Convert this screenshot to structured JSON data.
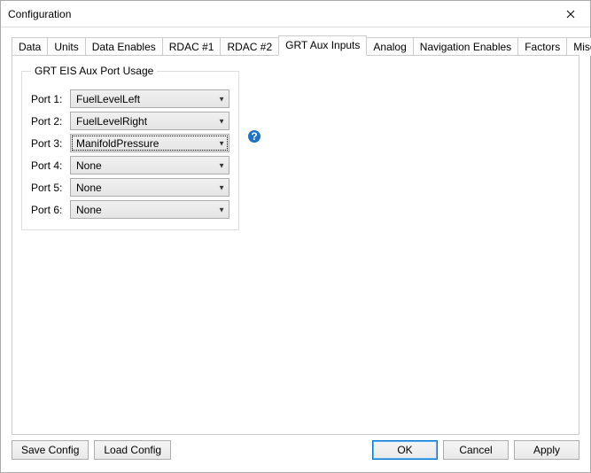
{
  "window": {
    "title": "Configuration"
  },
  "tabs": {
    "items": [
      {
        "label": "Data"
      },
      {
        "label": "Units"
      },
      {
        "label": "Data Enables"
      },
      {
        "label": "RDAC #1"
      },
      {
        "label": "RDAC #2"
      },
      {
        "label": "GRT Aux Inputs"
      },
      {
        "label": "Analog"
      },
      {
        "label": "Navigation Enables"
      },
      {
        "label": "Factors"
      },
      {
        "label": "Misc."
      }
    ],
    "active_index": 5,
    "scroll_left": "◂",
    "scroll_right": "▸"
  },
  "group": {
    "legend": "GRT EIS Aux Port Usage",
    "ports": [
      {
        "label": "Port 1:",
        "value": "FuelLevelLeft"
      },
      {
        "label": "Port 2:",
        "value": "FuelLevelRight"
      },
      {
        "label": "Port 3:",
        "value": "ManifoldPressure"
      },
      {
        "label": "Port 4:",
        "value": "None"
      },
      {
        "label": "Port 5:",
        "value": "None"
      },
      {
        "label": "Port 6:",
        "value": "None"
      }
    ]
  },
  "help": {
    "text": "?"
  },
  "buttons": {
    "save_config": "Save Config",
    "load_config": "Load Config",
    "ok": "OK",
    "cancel": "Cancel",
    "apply": "Apply"
  }
}
